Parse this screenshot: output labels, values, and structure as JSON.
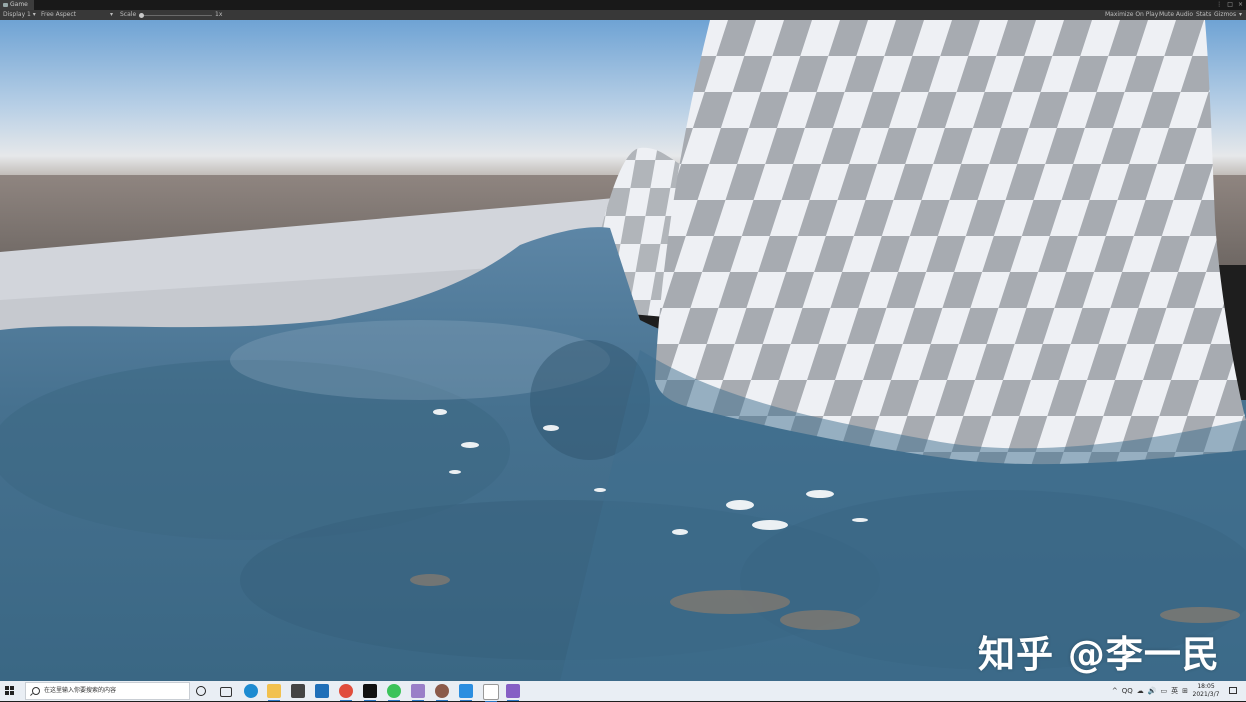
{
  "window": {
    "tab_label": "Game",
    "controls": [
      "⋮",
      "□",
      "×"
    ]
  },
  "toolbar": {
    "display": "Display 1",
    "aspect": "Free Aspect",
    "scale_label": "Scale",
    "scale_value": "1x",
    "maximize_on_play": "Maximize On Play",
    "mute_audio": "Mute Audio",
    "stats": "Stats",
    "gizmos": "Gizmos"
  },
  "viewport": {
    "watermark": "知乎 @李一民",
    "colors": {
      "sky_top": "#6fa3d4",
      "horizon": "#e6e8ea",
      "ground": "#716a66",
      "water": "#3d6c8c",
      "checker_light": "#f0f2f6",
      "checker_dark": "#a9adb3"
    }
  },
  "taskbar": {
    "search_placeholder": "在这里输入你要搜索的内容",
    "apps": [
      "cortana-icon",
      "task-view-icon",
      "edge-icon",
      "file-explorer-icon",
      "store-icon",
      "mail-icon",
      "chrome-icon",
      "unity-icon",
      "wechat-icon",
      "app-icon",
      "app-icon-2",
      "app-icon-3",
      "unity-hub-icon",
      "visual-studio-icon"
    ],
    "tray": [
      "^",
      "QQ",
      "☁",
      "🔊",
      "▭",
      "英",
      "⊞"
    ],
    "time": "18:05",
    "date": "2021/3/7"
  }
}
